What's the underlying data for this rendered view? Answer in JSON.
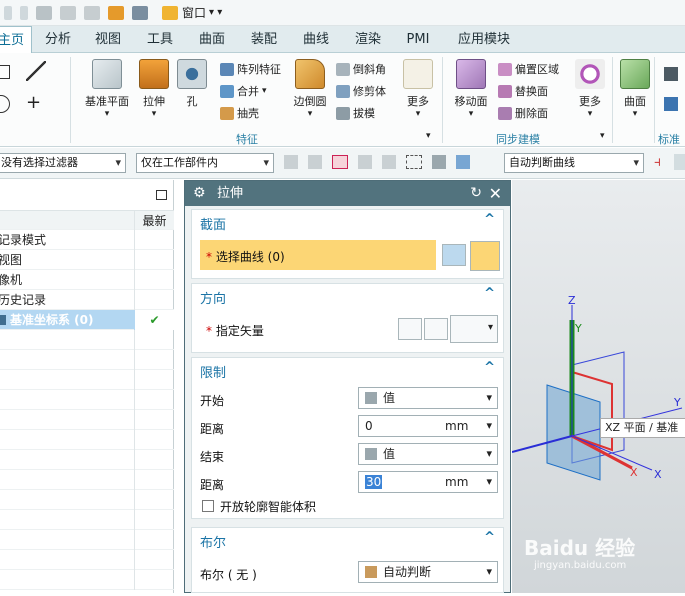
{
  "quick_access": {
    "window_menu": "窗口"
  },
  "tabs": [
    {
      "label": "主页"
    },
    {
      "label": "分析"
    },
    {
      "label": "视图"
    },
    {
      "label": "工具"
    },
    {
      "label": "曲面"
    },
    {
      "label": "装配"
    },
    {
      "label": "曲线"
    },
    {
      "label": "渲染"
    },
    {
      "label": "PMI"
    },
    {
      "label": "应用模块"
    }
  ],
  "ribbon": {
    "datum_plane": "基准平面",
    "extrude": "拉伸",
    "hole": "孔",
    "pattern_feature": "阵列特征",
    "unite": "合并",
    "shell": "抽壳",
    "edge_blend": "边倒圆",
    "chamfer": "倒斜角",
    "trim_body": "修剪体",
    "draft": "拔模",
    "more1": "更多",
    "feature_group": "特征",
    "move_face": "移动面",
    "offset_region": "偏置区域",
    "replace_face": "替换面",
    "delete_face": "删除面",
    "more2": "更多",
    "sync_group": "同步建模",
    "surface": "曲面",
    "std_group": "标准化"
  },
  "filter_bar": {
    "selection_filter": "没有选择过滤器",
    "scope": "仅在工作部件内",
    "curve_rule": "自动判断曲线"
  },
  "navigator": {
    "col_latest": "最新",
    "rows": [
      {
        "label": "记录模式"
      },
      {
        "label": "视图"
      },
      {
        "label": "像机"
      },
      {
        "label": "历史记录"
      },
      {
        "label": "基准坐标系 (0)",
        "latest": "✔"
      }
    ]
  },
  "dialog": {
    "title": "拉伸",
    "section": {
      "header": "截面",
      "select_curve": "选择曲线 (0)"
    },
    "direction": {
      "header": "方向",
      "specify_vector": "指定矢量"
    },
    "limits": {
      "header": "限制",
      "start_label": "开始",
      "start_value": "值",
      "dist1_label": "距离",
      "dist1_value": "0",
      "dist1_unit": "mm",
      "end_label": "结束",
      "end_value": "值",
      "dist2_label": "距离",
      "dist2_value": "30",
      "dist2_unit": "mm",
      "open_profile": "开放轮廓智能体积"
    },
    "boolean": {
      "header": "布尔",
      "bool_label": "布尔 ( 无 )",
      "bool_value": "自动判断"
    }
  },
  "viewport": {
    "label_z": "Z",
    "label_y": "Y",
    "label_x": "X",
    "label_y2": "Y",
    "label_x2": "X",
    "tooltip": "XZ 平面 / 基准"
  },
  "watermark": {
    "brand": "Baidu 经验",
    "url": "jingyan.baidu.com"
  }
}
